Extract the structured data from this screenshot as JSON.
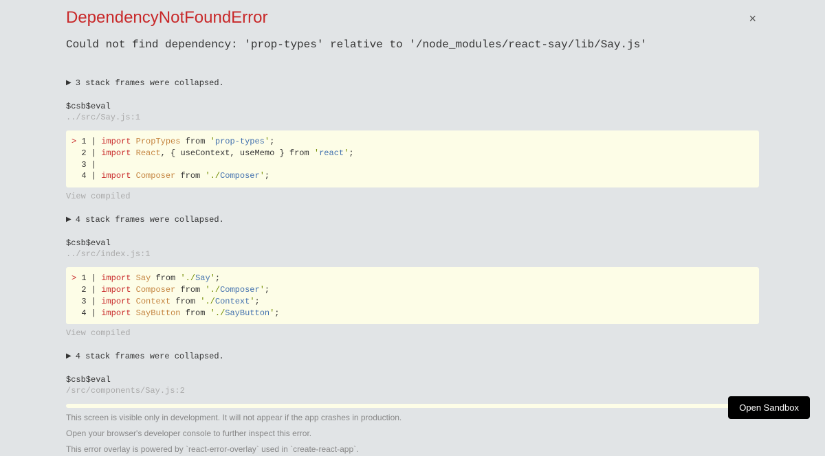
{
  "header": {
    "title": "DependencyNotFoundError",
    "message": "Could not find dependency: 'prop-types' relative to '/node_modules/react-say/lib/Say.js'"
  },
  "close_label": "×",
  "frames": [
    {
      "collapse_text": "3 stack frames were collapsed.",
      "eval_label": "$csb$eval",
      "file_path": "../src/Say.js:1",
      "code": [
        {
          "mark": ">",
          "ln": "1",
          "tokens": [
            {
              "t": "import ",
              "c": "kw"
            },
            {
              "t": "PropTypes",
              "c": "cls"
            },
            {
              "t": " from ",
              "c": "norm"
            },
            {
              "t": "'",
              "c": "str-q"
            },
            {
              "t": "prop-types",
              "c": "str-mod"
            },
            {
              "t": "'",
              "c": "str-q"
            },
            {
              "t": ";",
              "c": "norm"
            }
          ]
        },
        {
          "mark": " ",
          "ln": "2",
          "tokens": [
            {
              "t": "import ",
              "c": "kw"
            },
            {
              "t": "React",
              "c": "cls"
            },
            {
              "t": ", { useContext, useMemo } from ",
              "c": "norm"
            },
            {
              "t": "'",
              "c": "str-q"
            },
            {
              "t": "react",
              "c": "str-mod"
            },
            {
              "t": "'",
              "c": "str-q"
            },
            {
              "t": ";",
              "c": "norm"
            }
          ]
        },
        {
          "mark": " ",
          "ln": "3",
          "tokens": []
        },
        {
          "mark": " ",
          "ln": "4",
          "tokens": [
            {
              "t": "import ",
              "c": "kw"
            },
            {
              "t": "Composer",
              "c": "cls"
            },
            {
              "t": " from ",
              "c": "norm"
            },
            {
              "t": "'",
              "c": "str-q"
            },
            {
              "t": "./",
              "c": "str-q"
            },
            {
              "t": "Composer",
              "c": "str-mod"
            },
            {
              "t": "'",
              "c": "str-q"
            },
            {
              "t": ";",
              "c": "norm"
            }
          ]
        }
      ],
      "view_compiled": "View compiled"
    },
    {
      "collapse_text": "4 stack frames were collapsed.",
      "eval_label": "$csb$eval",
      "file_path": "../src/index.js:1",
      "code": [
        {
          "mark": ">",
          "ln": "1",
          "tokens": [
            {
              "t": "import ",
              "c": "kw"
            },
            {
              "t": "Say",
              "c": "cls"
            },
            {
              "t": " from ",
              "c": "norm"
            },
            {
              "t": "'",
              "c": "str-q"
            },
            {
              "t": "./",
              "c": "str-q"
            },
            {
              "t": "Say",
              "c": "str-mod"
            },
            {
              "t": "'",
              "c": "str-q"
            },
            {
              "t": ";",
              "c": "norm"
            }
          ]
        },
        {
          "mark": " ",
          "ln": "2",
          "tokens": [
            {
              "t": "import ",
              "c": "kw"
            },
            {
              "t": "Composer",
              "c": "cls"
            },
            {
              "t": " from ",
              "c": "norm"
            },
            {
              "t": "'",
              "c": "str-q"
            },
            {
              "t": "./",
              "c": "str-q"
            },
            {
              "t": "Composer",
              "c": "str-mod"
            },
            {
              "t": "'",
              "c": "str-q"
            },
            {
              "t": ";",
              "c": "norm"
            }
          ]
        },
        {
          "mark": " ",
          "ln": "3",
          "tokens": [
            {
              "t": "import ",
              "c": "kw"
            },
            {
              "t": "Context",
              "c": "cls"
            },
            {
              "t": " from ",
              "c": "norm"
            },
            {
              "t": "'",
              "c": "str-q"
            },
            {
              "t": "./",
              "c": "str-q"
            },
            {
              "t": "Context",
              "c": "str-mod"
            },
            {
              "t": "'",
              "c": "str-q"
            },
            {
              "t": ";",
              "c": "norm"
            }
          ]
        },
        {
          "mark": " ",
          "ln": "4",
          "tokens": [
            {
              "t": "import ",
              "c": "kw"
            },
            {
              "t": "SayButton",
              "c": "cls"
            },
            {
              "t": " from ",
              "c": "norm"
            },
            {
              "t": "'",
              "c": "str-q"
            },
            {
              "t": "./",
              "c": "str-q"
            },
            {
              "t": "SayButton",
              "c": "str-mod"
            },
            {
              "t": "'",
              "c": "str-q"
            },
            {
              "t": ";",
              "c": "norm"
            }
          ]
        }
      ],
      "view_compiled": "View compiled"
    },
    {
      "collapse_text": "4 stack frames were collapsed.",
      "eval_label": "$csb$eval",
      "file_path": "/src/components/Say.js:2",
      "strip_only": true
    }
  ],
  "footer": {
    "line1": "This screen is visible only in development. It will not appear if the app crashes in production.",
    "line2": "Open your browser's developer console to further inspect this error.",
    "line3": "This error overlay is powered by `react-error-overlay` used in `create-react-app`."
  },
  "open_sandbox_label": "Open Sandbox"
}
